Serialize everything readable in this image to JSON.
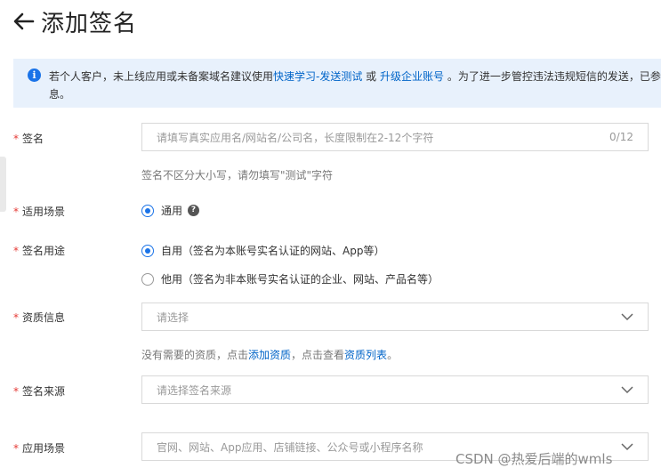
{
  "header": {
    "title": "添加签名",
    "back_icon": "arrow-left-icon"
  },
  "notice": {
    "text_before": "若个人客户，未上线应用或未备案域名建议使用",
    "link1": "快速学习-发送测试",
    "text_or": " 或 ",
    "link2": "升级企业账号",
    "text_after": " 。为了进一步管控违法违规短信的发送，已参",
    "line2": "息。"
  },
  "form": {
    "signature": {
      "required": "*",
      "label": "签名",
      "placeholder": "请填写真实应用名/网站名/公司名，长度限制在2-12个字符",
      "counter": "0/12",
      "hint": "签名不区分大小写，请勿填写\"测试\"字符"
    },
    "scenario": {
      "required": "*",
      "label": "适用场景",
      "option": "通用"
    },
    "usage": {
      "required": "*",
      "label": "签名用途",
      "option1": "自用",
      "option1_sub": "（签名为本账号实名认证的网站、App等）",
      "option2": "他用",
      "option2_sub": "（签名为非本账号实名认证的企业、网站、产品名等）"
    },
    "qualification": {
      "required": "*",
      "label": "资质信息",
      "placeholder": "请选择",
      "hint_before": "没有需要的资质，点击",
      "hint_link1": "添加资质",
      "hint_mid": "，点击查看",
      "hint_link2": "资质列表",
      "hint_after": "。"
    },
    "source": {
      "required": "*",
      "label": "签名来源",
      "placeholder": "请选择签名来源"
    },
    "app_scene": {
      "required": "*",
      "label": "应用场景",
      "placeholder": "官网、网站、App应用、店铺链接、公众号或小程序名称"
    }
  },
  "watermark": "CSDN @热爱后端的wmls",
  "colors": {
    "accent": "#1a73e8",
    "link": "#0064c8",
    "required": "#e53935",
    "notice_bg": "#e8f1fc"
  }
}
